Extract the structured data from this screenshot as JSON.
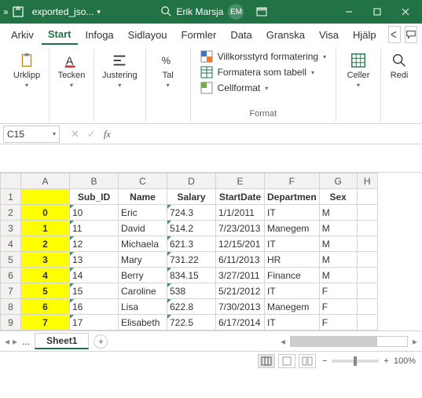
{
  "titlebar": {
    "filename": "exported_jso...",
    "user": "Erik Marsja",
    "initials": "EM"
  },
  "menu": {
    "tabs": [
      "Arkiv",
      "Start",
      "Infoga",
      "Sidlayou",
      "Formler",
      "Data",
      "Granska",
      "Visa",
      "Hjälp"
    ],
    "active_index": 1
  },
  "ribbon": {
    "clipboard": "Urklipp",
    "font": "Tecken",
    "align": "Justering",
    "number": "Tal",
    "cond": "Villkorsstyrd formatering",
    "table": "Formatera som tabell",
    "cellfmt": "Cellformat",
    "format_group": "Format",
    "cells": "Celler",
    "editing": "Redi"
  },
  "namebox": "C15",
  "chart_data": {
    "type": "table",
    "columns": [
      "",
      "Sub_ID",
      "Name",
      "Salary",
      "StartDate",
      "Department",
      "Sex"
    ],
    "rows": [
      [
        "0",
        "10",
        "Eric",
        "724.3",
        "1/1/2011",
        "IT",
        "M"
      ],
      [
        "1",
        "11",
        "David",
        "514.2",
        "7/23/2013",
        "Manegem",
        "M"
      ],
      [
        "2",
        "12",
        "Michaela",
        "621.3",
        "12/15/201",
        "IT",
        "M"
      ],
      [
        "3",
        "13",
        "Mary",
        "731.22",
        "6/11/2013",
        "HR",
        "M"
      ],
      [
        "4",
        "14",
        "Berry",
        "834.15",
        "3/27/2011",
        "Finance",
        "M"
      ],
      [
        "5",
        "15",
        "Caroline",
        "538",
        "5/21/2012",
        "IT",
        "F"
      ],
      [
        "6",
        "16",
        "Lisa",
        "622.8",
        "7/30/2013",
        "Manegem",
        "F"
      ],
      [
        "7",
        "17",
        "Elisabeth",
        "722.5",
        "6/17/2014",
        "IT",
        "F"
      ]
    ]
  },
  "col_letters": [
    "A",
    "B",
    "C",
    "D",
    "E",
    "F",
    "G",
    "H"
  ],
  "row_nums": [
    "1",
    "2",
    "3",
    "4",
    "5",
    "6",
    "7",
    "8",
    "9"
  ],
  "headers": {
    "A": "",
    "B": "Sub_ID",
    "C": "Name",
    "D": "Salary",
    "E": "StartDate",
    "F": "Departmen",
    "G": "Sex"
  },
  "sheet": "Sheet1",
  "ellipsis": "...",
  "zoom": "100%"
}
